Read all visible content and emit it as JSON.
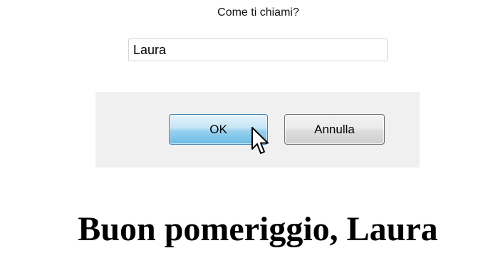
{
  "dialog": {
    "prompt": "Come ti chiami?",
    "name_value": "Laura",
    "ok_label": "OK",
    "cancel_label": "Annulla"
  },
  "greeting": {
    "text": "Buon pomeriggio, Laura"
  },
  "cursor": {
    "icon": "arrow-pointer-icon"
  },
  "colors": {
    "ok_border": "#3c7fb1",
    "button_bar_bg": "#f0f0f0"
  }
}
